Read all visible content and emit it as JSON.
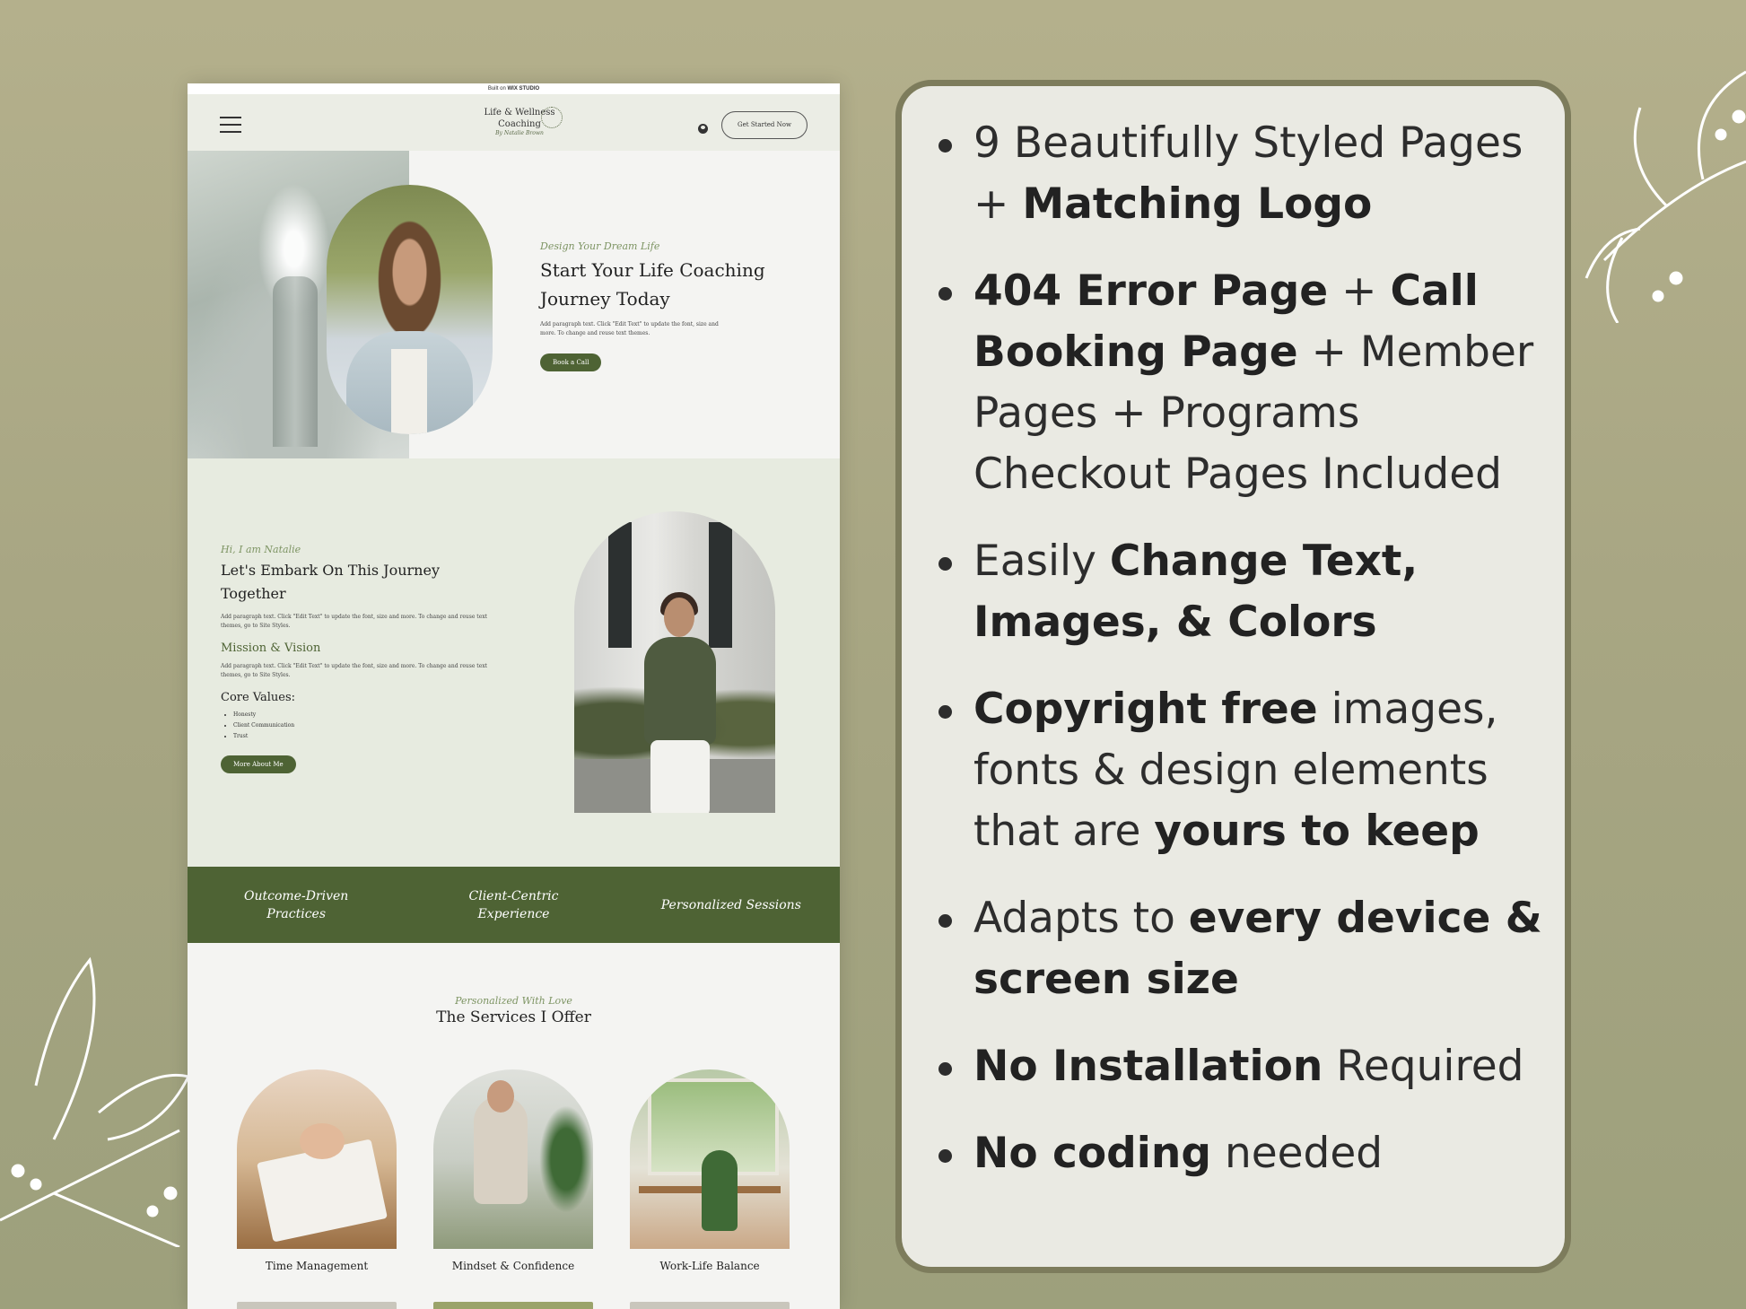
{
  "mockup": {
    "built_bar": {
      "prefix": "Built on",
      "brand": "WIX STUDIO"
    },
    "header": {
      "logo_line1": "Life & Wellness",
      "logo_line2": "Coaching",
      "logo_signature": "By Natalie Brown",
      "cta_label": "Get Started Now",
      "icons": [
        "hamburger-menu-icon",
        "user-account-icon"
      ]
    },
    "hero": {
      "script": "Design Your Dream Life",
      "title_line1": "Start Your Life Coaching",
      "title_line2": "Journey Today",
      "paragraph": "Add paragraph text. Click \"Edit Text\" to update the font, size and more. To change and reuse text themes.",
      "button": "Book a Call"
    },
    "about": {
      "script": "Hi, I am Natalie",
      "title_line1": "Let's Embark On This Journey",
      "title_line2": "Together",
      "paragraph1": "Add paragraph text. Click \"Edit Text\" to update the font, size and more. To change and reuse text themes, go to Site Styles.",
      "mission_heading": "Mission & Vision",
      "paragraph2": "Add paragraph text. Click \"Edit Text\" to update the font, size and more. To change and reuse text themes, go to Site Styles.",
      "values_heading": "Core Values:",
      "values": [
        "Honesty",
        "Client Communication",
        "Trust"
      ],
      "button": "More About Me"
    },
    "band": {
      "item1_line1": "Outcome-Driven",
      "item1_line2": "Practices",
      "item2_line1": "Client-Centric",
      "item2_line2": "Experience",
      "item3": "Personalized Sessions"
    },
    "services": {
      "script": "Personalized With Love",
      "title": "The Services I Offer",
      "cards": [
        "Time Management",
        "Mindset & Confidence",
        "Work-Life Balance"
      ]
    },
    "colors": {
      "brand_green": "#4e6334",
      "accent_green": "#7d9463",
      "about_bg": "#e7ebe0"
    }
  },
  "features": [
    {
      "parts": [
        {
          "text": "9 Beautifully Styled Pages + ",
          "bold": false
        },
        {
          "text": "Matching Logo",
          "bold": true
        }
      ]
    },
    {
      "parts": [
        {
          "text": "404 Error Page",
          "bold": true
        },
        {
          "text": " + ",
          "bold": false
        },
        {
          "text": "Call Booking Page",
          "bold": true
        },
        {
          "text": " + Member Pages + Programs Checkout Pages Included",
          "bold": false
        }
      ]
    },
    {
      "parts": [
        {
          "text": "Easily ",
          "bold": false
        },
        {
          "text": "Change Text, Images, & Colors",
          "bold": true
        }
      ]
    },
    {
      "parts": [
        {
          "text": "Copyright free",
          "bold": true
        },
        {
          "text": " images, fonts & design elements that are ",
          "bold": false
        },
        {
          "text": "yours to keep",
          "bold": true
        }
      ]
    },
    {
      "parts": [
        {
          "text": "Adapts to ",
          "bold": false
        },
        {
          "text": "every device & screen size",
          "bold": true
        }
      ]
    },
    {
      "parts": [
        {
          "text": "No Installation",
          "bold": true
        },
        {
          "text": " Required",
          "bold": false
        }
      ]
    },
    {
      "parts": [
        {
          "text": "No coding",
          "bold": true
        },
        {
          "text": " needed",
          "bold": false
        }
      ]
    }
  ],
  "panel_border_color": "#7d7c5c"
}
